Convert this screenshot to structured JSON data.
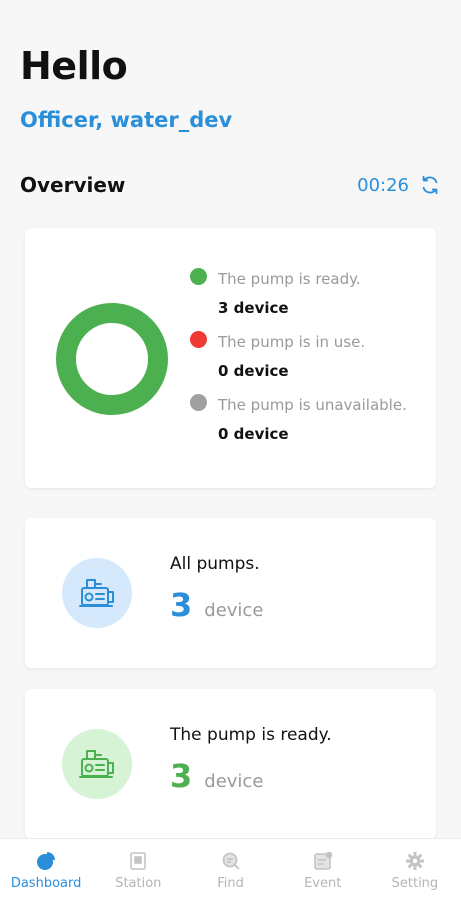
{
  "header": {
    "greeting": "Hello",
    "user": "Officer, water_dev"
  },
  "overview": {
    "title": "Overview",
    "timer": "00:26"
  },
  "colors": {
    "accent": "#2a8fd8",
    "ready": "#4caf50",
    "in_use": "#ef3b33",
    "unavailable": "#a0a0a0"
  },
  "status": {
    "items": [
      {
        "label": "The pump is ready.",
        "count": "3 device"
      },
      {
        "label": "The pump is in use.",
        "count": "0 device"
      },
      {
        "label": "The pump is unavailable.",
        "count": "0 device"
      }
    ],
    "donut_values": {
      "ready": 3,
      "in_use": 0,
      "unavailable": 0
    }
  },
  "summary": {
    "all": {
      "title": "All pumps.",
      "value": "3",
      "unit": "device",
      "icon": "pump-icon"
    },
    "ready": {
      "title": "The pump is ready.",
      "value": "3",
      "unit": "device",
      "icon": "pump-icon"
    }
  },
  "nav": {
    "items": [
      {
        "label": "Dashboard",
        "icon": "dashboard-pie-icon",
        "active": true
      },
      {
        "label": "Station",
        "icon": "station-icon",
        "active": false
      },
      {
        "label": "Find",
        "icon": "find-icon",
        "active": false
      },
      {
        "label": "Event",
        "icon": "event-icon",
        "active": false
      },
      {
        "label": "Setting",
        "icon": "gear-icon",
        "active": false
      }
    ]
  }
}
